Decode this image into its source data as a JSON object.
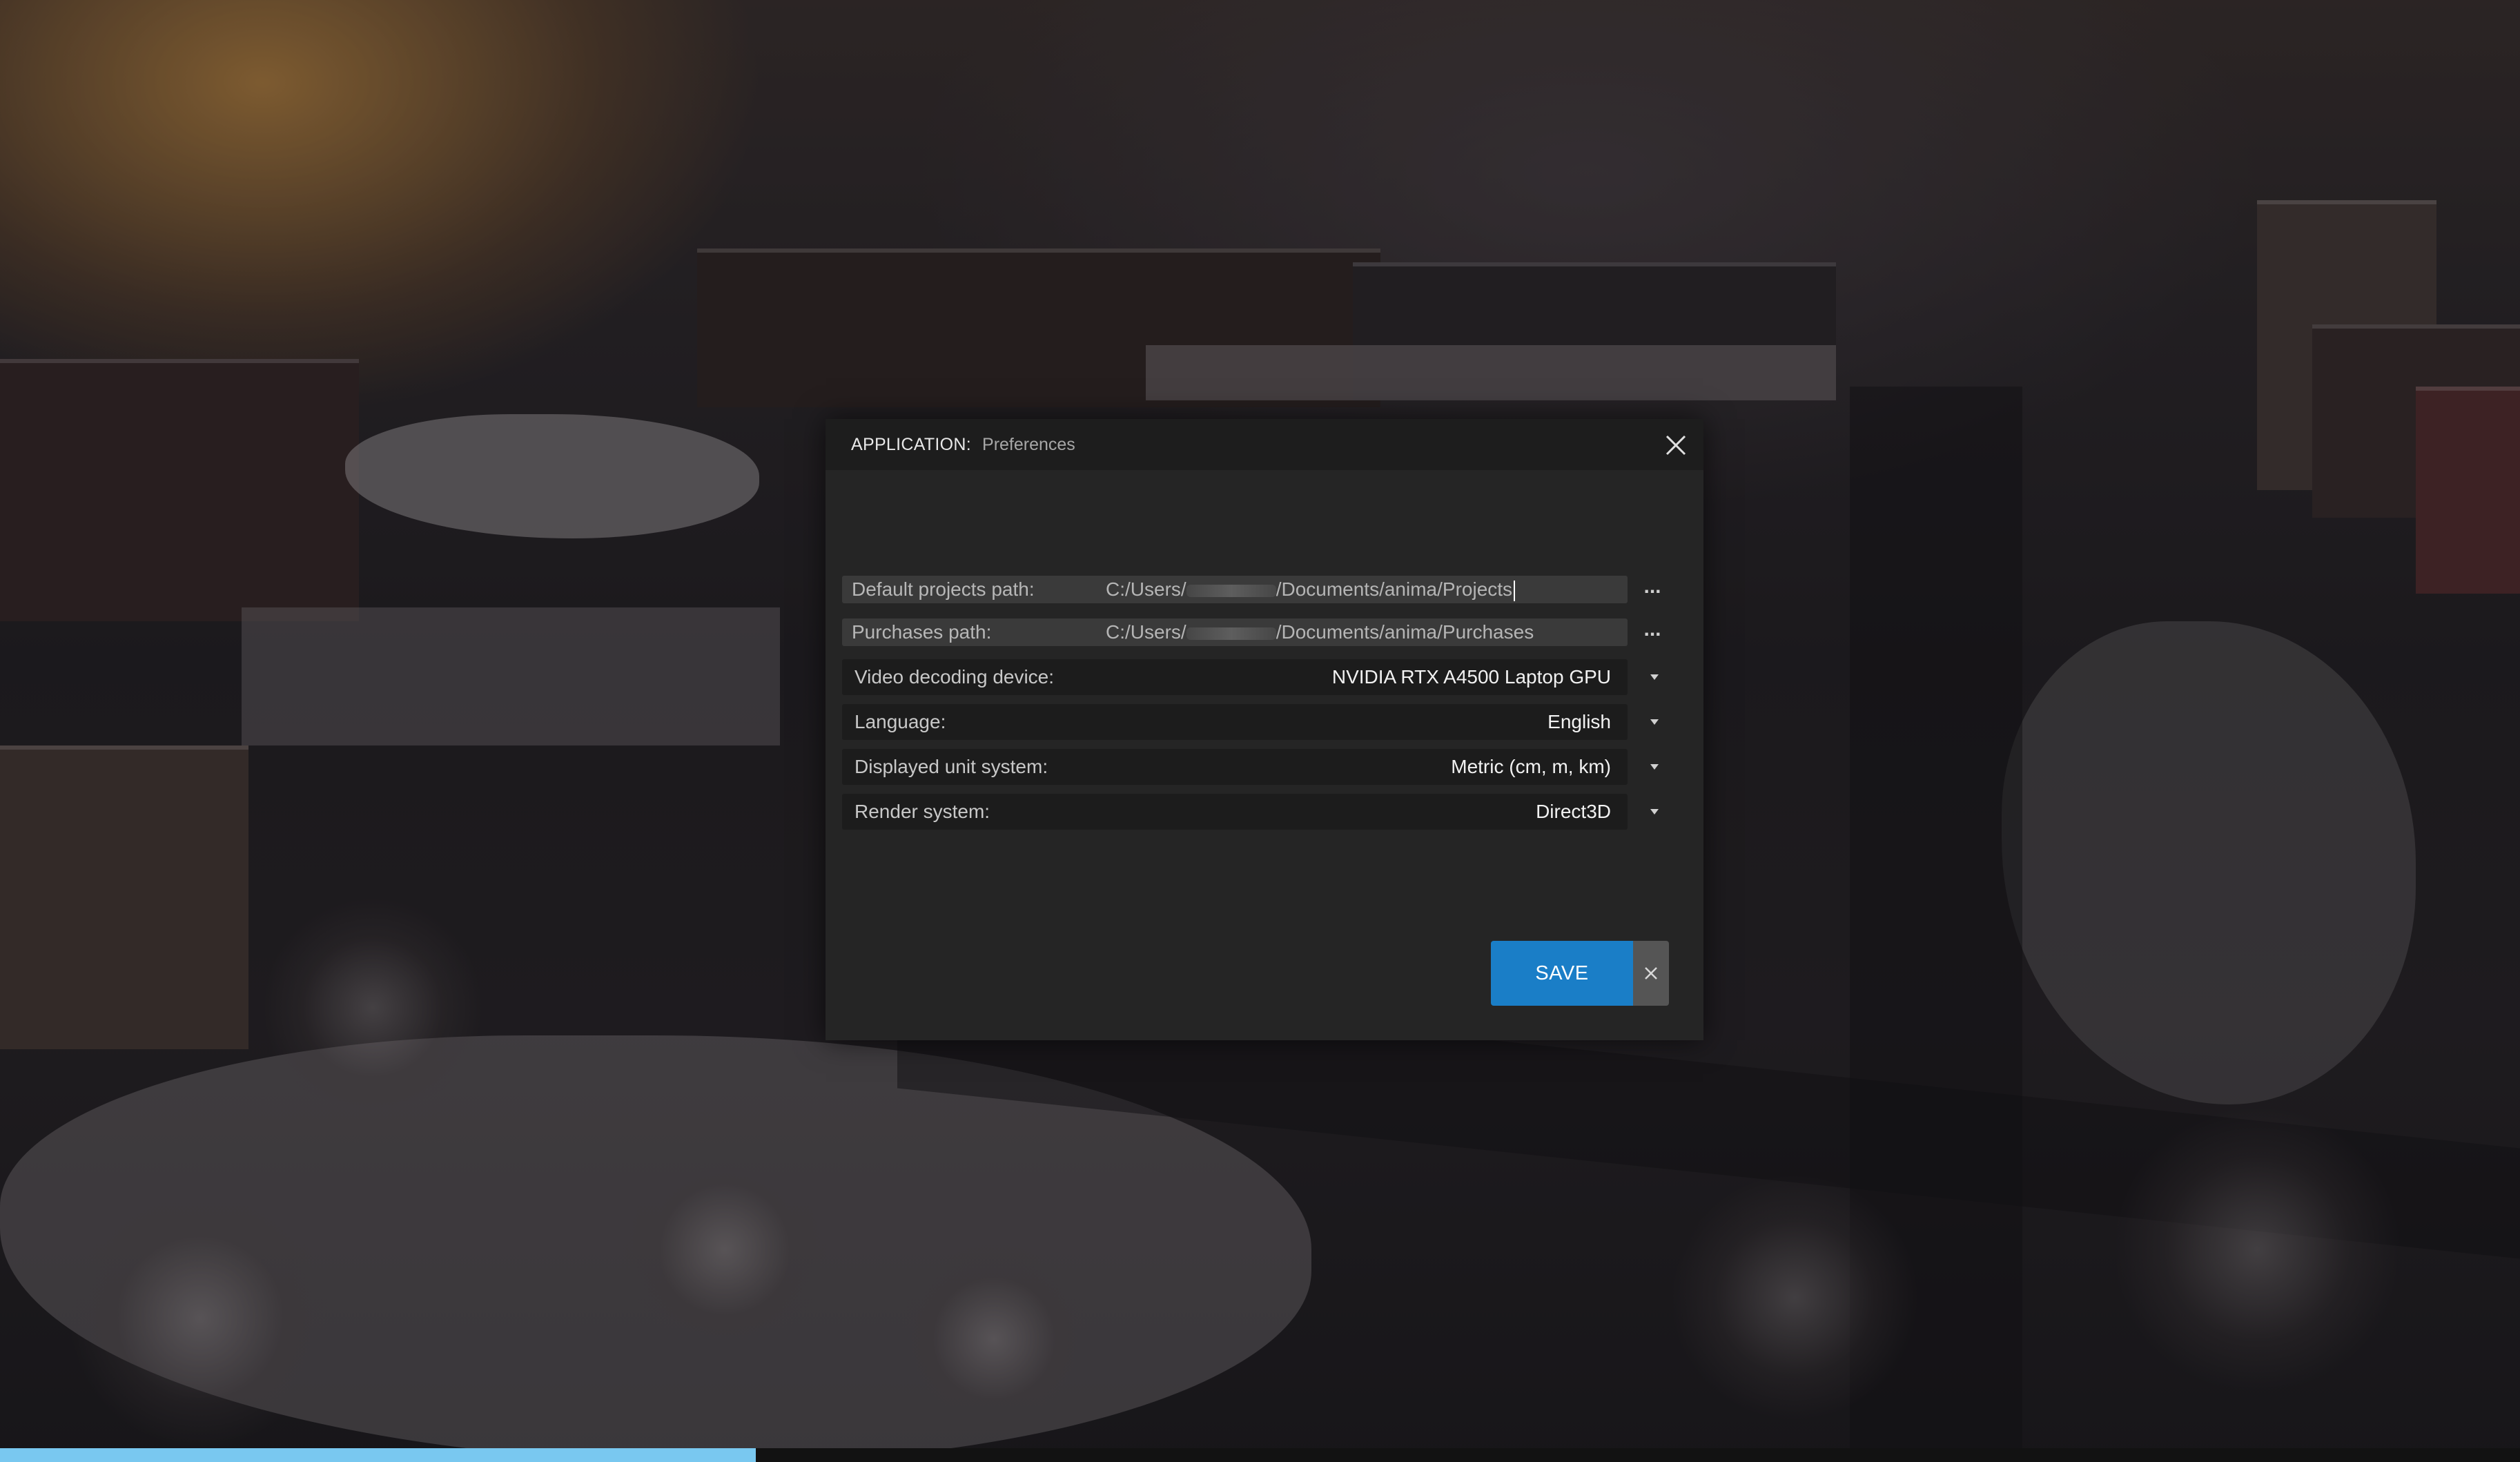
{
  "dialog": {
    "title_app": "APPLICATION:",
    "title_page": "Preferences",
    "close_icon": "close-icon"
  },
  "settings": {
    "default_projects_path": {
      "label": "Default projects path:",
      "value_prefix": "C:/Users/",
      "value_suffix": "/Documents/anima/Projects",
      "browse_label": "..."
    },
    "purchases_path": {
      "label": "Purchases path:",
      "value_prefix": "C:/Users/",
      "value_suffix": "/Documents/anima/Purchases",
      "browse_label": "..."
    },
    "video_decoding_device": {
      "label": "Video decoding device:",
      "value": "NVIDIA RTX A4500 Laptop GPU"
    },
    "language": {
      "label": "Language:",
      "value": "English"
    },
    "displayed_unit_system": {
      "label": "Displayed unit system:",
      "value": "Metric (cm, m, km)"
    },
    "render_system": {
      "label": "Render system:",
      "value": "Direct3D"
    }
  },
  "actions": {
    "save_label": "SAVE"
  },
  "progress": {
    "fraction": 0.3
  },
  "colors": {
    "accent": "#1a7ec7",
    "progress": "#79c8f0",
    "dialog_bg": "#252525"
  }
}
